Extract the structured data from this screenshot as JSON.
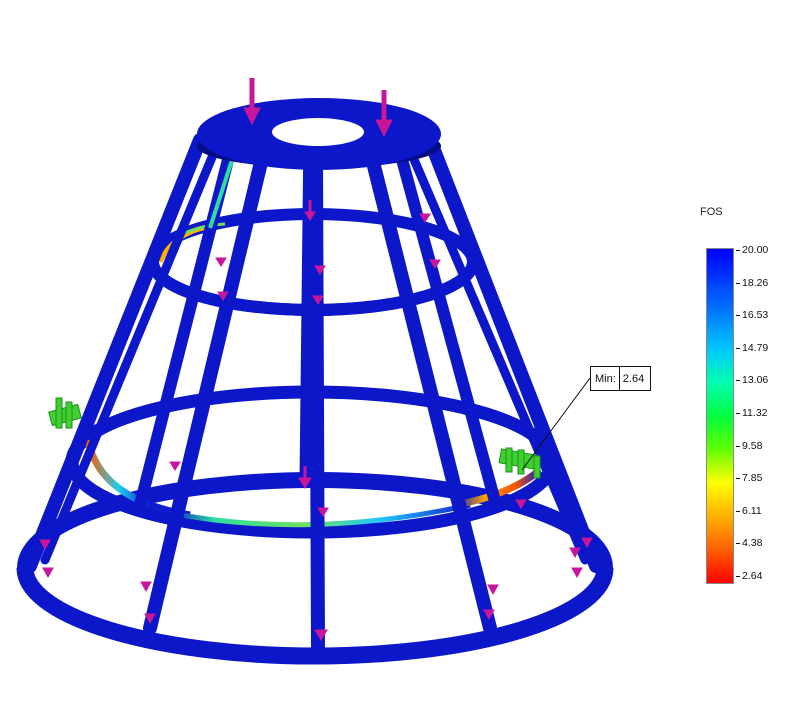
{
  "legend": {
    "title": "FOS",
    "ticks": [
      "20.00",
      "18.26",
      "16.53",
      "14.79",
      "13.06",
      "11.32",
      "9.58",
      "7.85",
      "6.11",
      "4.38",
      "2.64"
    ],
    "colors": [
      "#0000ff",
      "#0040ff",
      "#0080ff",
      "#00c8ff",
      "#00ffb0",
      "#00ff40",
      "#60ff00",
      "#ffff00",
      "#ffb000",
      "#ff6000",
      "#ff0000"
    ]
  },
  "probe": {
    "label": "Min:",
    "value": "2.64"
  },
  "colors": {
    "frame": "#0c17c9",
    "frame_dark": "#050c86",
    "load_arrow": "#c8169c",
    "fixture": "#3fcf2f"
  }
}
